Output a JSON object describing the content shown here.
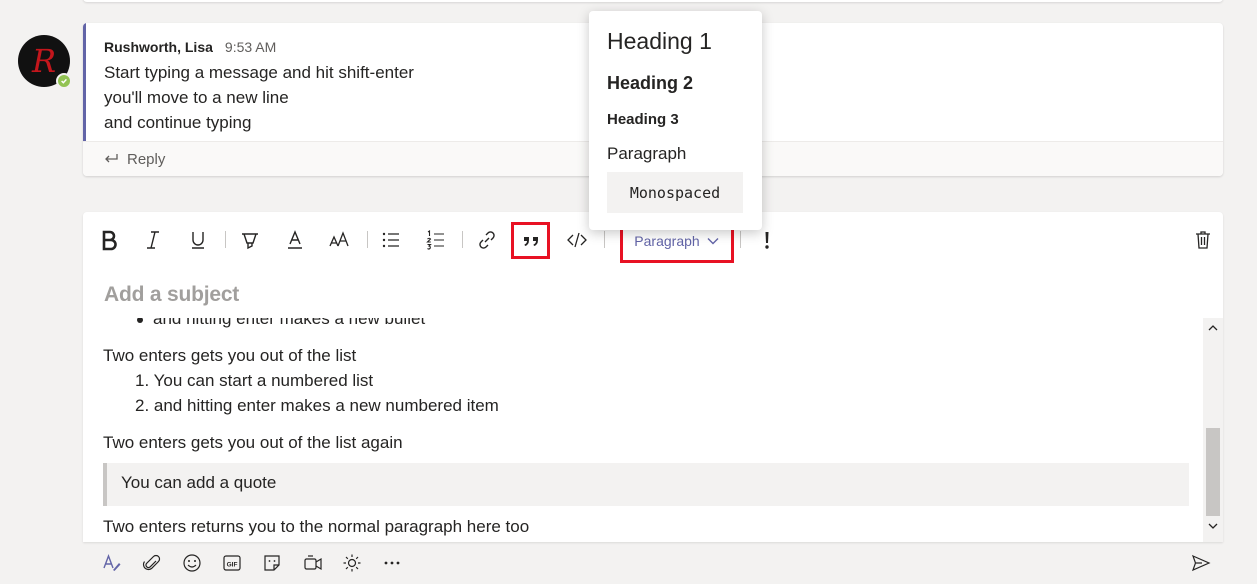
{
  "message": {
    "author": "Rushworth, Lisa",
    "time": "9:53 AM",
    "avatar_letter": "R",
    "lines": [
      "Start typing a message and hit shift-enter",
      "you'll move to a new line",
      "and continue typing"
    ],
    "reply_label": "Reply"
  },
  "toolbar": {
    "items": [
      "bold-icon",
      "italic-icon",
      "underline-icon",
      "highlight-icon",
      "font-color-icon",
      "font-size-icon",
      "bulleted-list-icon",
      "numbered-list-icon",
      "link-icon",
      "quote-icon",
      "code-icon",
      "paragraph-dropdown",
      "important-icon",
      "delete-icon"
    ],
    "paragraph_label": "Paragraph",
    "highlight_color": "#e81123"
  },
  "compose": {
    "subject_placeholder": "Add a subject",
    "bullet_partial": "and hitting enter makes a new bullet",
    "p1": "Two enters gets you out of the list",
    "numbered": [
      "1. You can start a numbered list",
      "2. and hitting enter makes a new numbered item"
    ],
    "p2": "Two enters gets you out of the list again",
    "quote": "You can add a quote",
    "p3": "Two enters returns you to the normal paragraph here too"
  },
  "format_menu": {
    "heading1": "Heading 1",
    "heading2": "Heading 2",
    "heading3": "Heading 3",
    "paragraph": "Paragraph",
    "monospaced": "Monospaced"
  },
  "bottom_bar": {
    "items": [
      "format-icon",
      "attach-icon",
      "emoji-icon",
      "gif-icon",
      "sticker-icon",
      "meet-now-icon",
      "praise-icon",
      "more-options-icon",
      "send-icon"
    ]
  },
  "colors": {
    "accent": "#6264a7",
    "presence": "#92c353"
  }
}
